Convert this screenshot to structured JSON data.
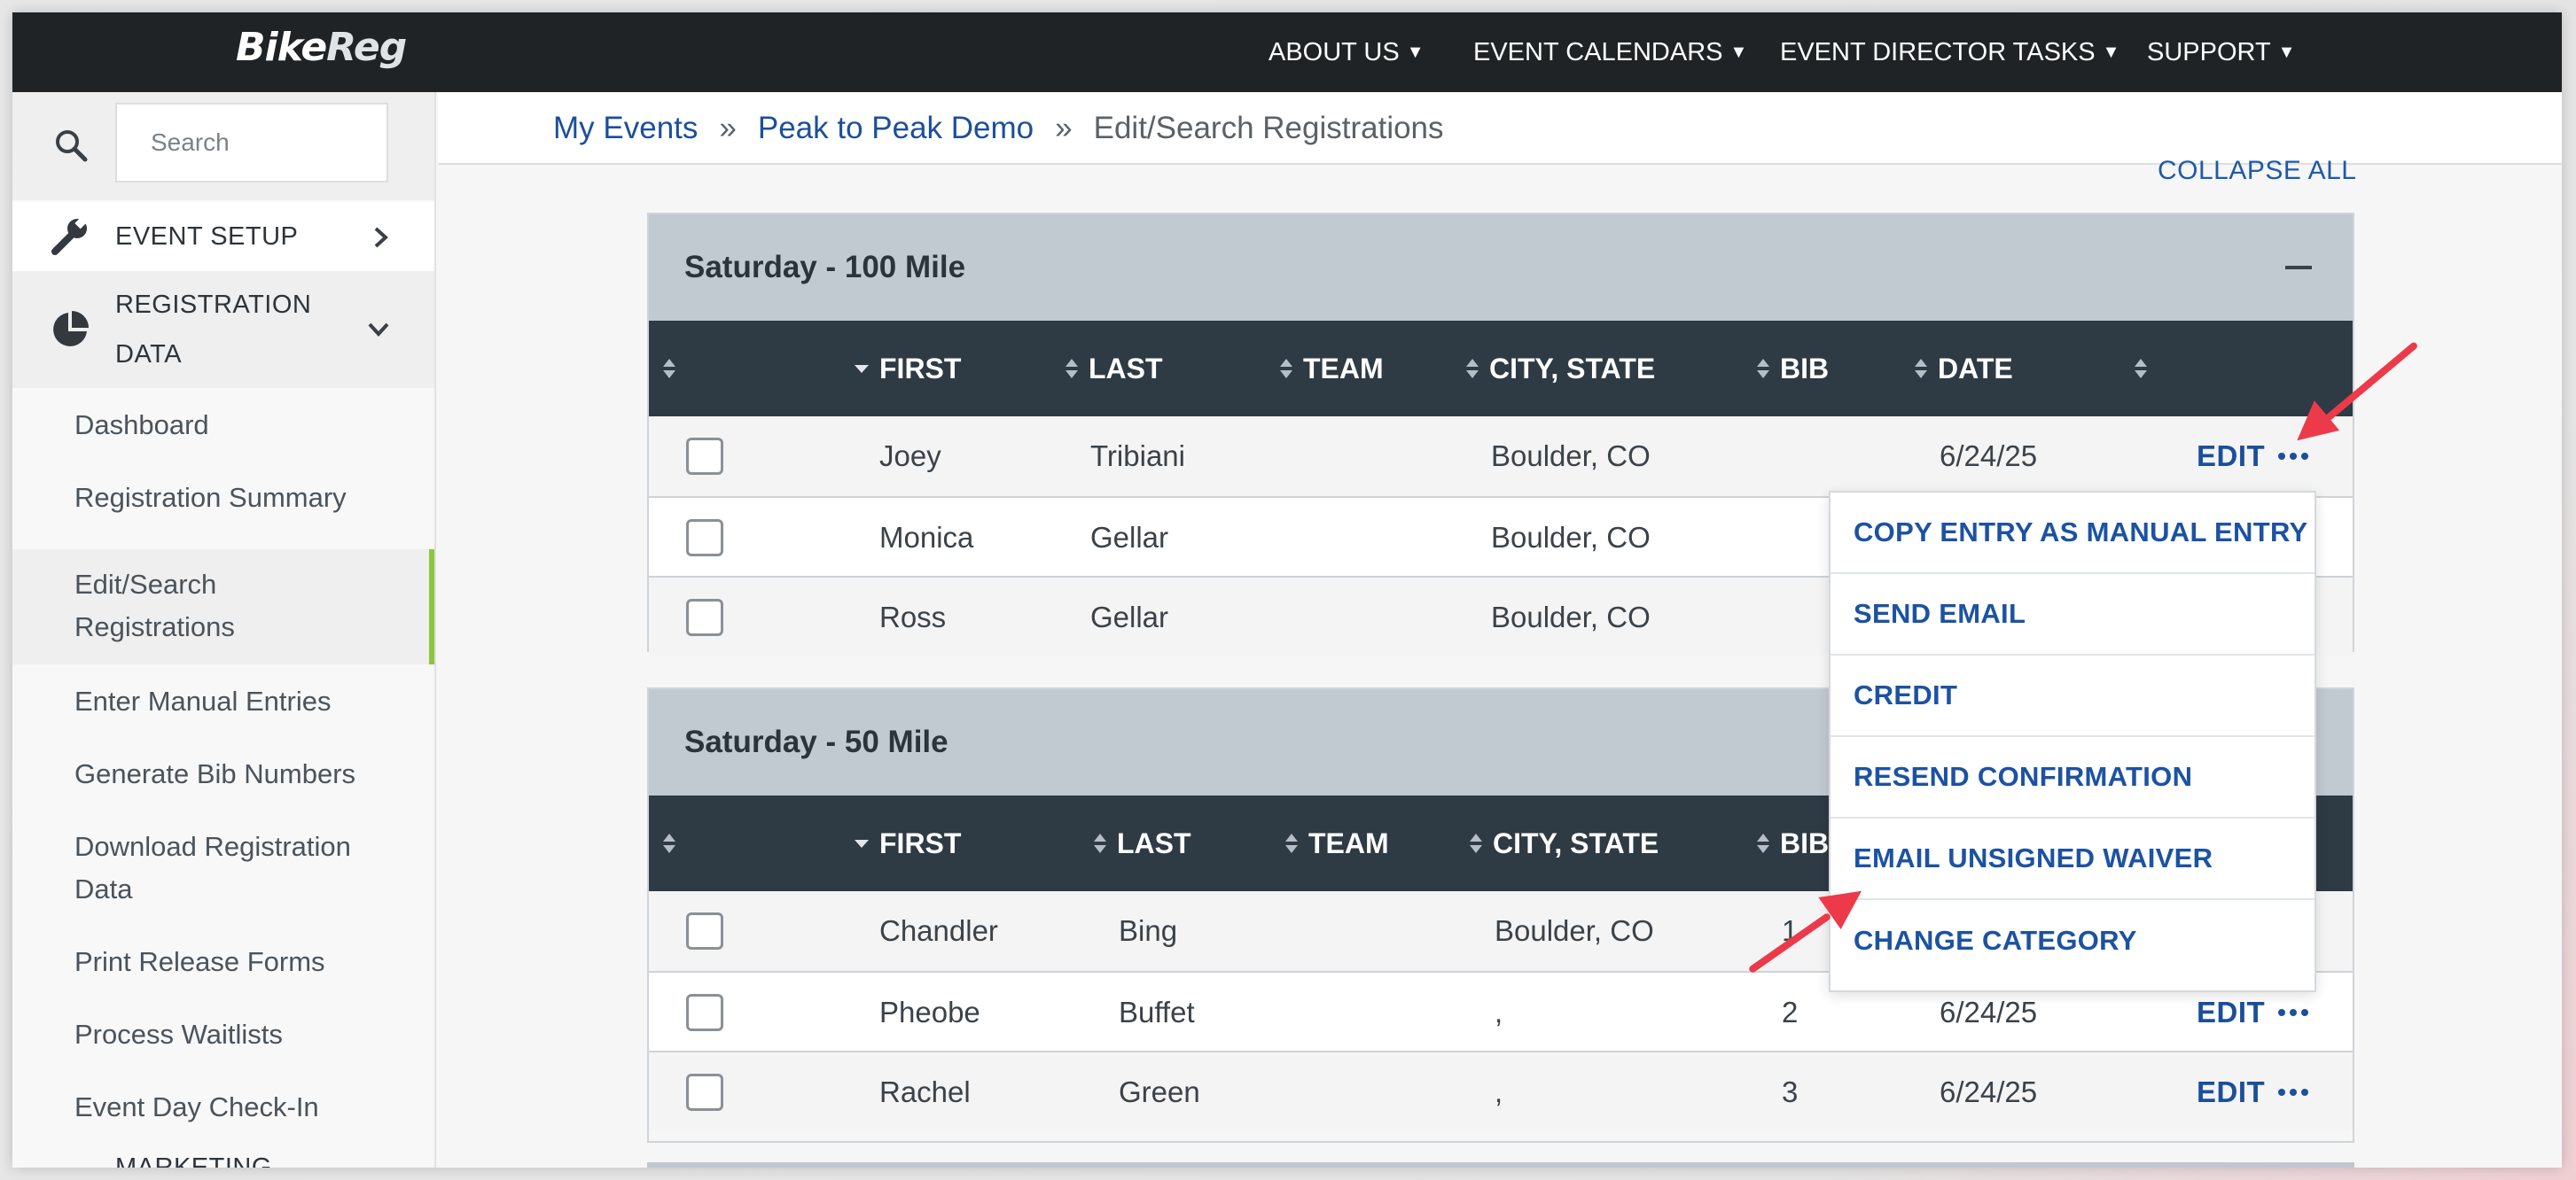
{
  "brand": {
    "logo_bike": "Bike",
    "logo_reg": "Reg"
  },
  "topnav": {
    "about": "ABOUT US",
    "calendars": "EVENT CALENDARS",
    "director": "EVENT DIRECTOR TASKS",
    "support": "SUPPORT"
  },
  "sidebar": {
    "search_placeholder": "Search",
    "event_setup": "EVENT SETUP",
    "registration_data_line1": "REGISTRATION",
    "registration_data_line2": "DATA",
    "items": [
      {
        "label": "Dashboard"
      },
      {
        "label": "Registration Summary"
      },
      {
        "label_line1": "Edit/Search",
        "label_line2": "Registrations",
        "active": true
      },
      {
        "label": "Enter Manual Entries"
      },
      {
        "label": "Generate Bib Numbers"
      },
      {
        "label_line1": "Download Registration",
        "label_line2": "Data"
      },
      {
        "label": "Print Release Forms"
      },
      {
        "label": "Process Waitlists"
      },
      {
        "label": "Event Day Check-In"
      }
    ],
    "marketing": "MARKETING"
  },
  "breadcrumb": {
    "my_events": "My Events",
    "sep": "»",
    "event": "Peak to Peak Demo",
    "current": "Edit/Search Registrations"
  },
  "collapse_all": "COLLAPSE ALL",
  "columns": {
    "first": "FIRST",
    "last": "LAST",
    "team": "TEAM",
    "city": "CITY, STATE",
    "bib": "BIB",
    "date": "DATE"
  },
  "edit_label": "EDIT",
  "groups": [
    {
      "title": "Saturday - 100 Mile",
      "rows": [
        {
          "first": "Joey",
          "last": "Tribiani",
          "team": "",
          "city": "Boulder, CO",
          "bib": "",
          "date": "6/24/25"
        },
        {
          "first": "Monica",
          "last": "Gellar",
          "team": "",
          "city": "Boulder, CO",
          "bib": "",
          "date": ""
        },
        {
          "first": "Ross",
          "last": "Gellar",
          "team": "",
          "city": "Boulder, CO",
          "bib": "",
          "date": ""
        }
      ]
    },
    {
      "title": "Saturday - 50 Mile",
      "rows": [
        {
          "first": "Chandler",
          "last": "Bing",
          "team": "",
          "city": "Boulder, CO",
          "bib": "1",
          "date": ""
        },
        {
          "first": "Pheobe",
          "last": "Buffet",
          "team": "",
          "city": ",",
          "bib": "2",
          "date": "6/24/25"
        },
        {
          "first": "Rachel",
          "last": "Green",
          "team": "",
          "city": ",",
          "bib": "3",
          "date": "6/24/25"
        }
      ]
    }
  ],
  "dropdown": [
    "COPY ENTRY AS MANUAL ENTRY",
    "SEND EMAIL",
    "CREDIT",
    "RESEND CONFIRMATION",
    "EMAIL UNSIGNED WAIVER",
    "CHANGE CATEGORY"
  ],
  "colors": {
    "topbar": "#1f2326",
    "link": "#1b4f9c",
    "table_header": "#2e3a44",
    "group_header": "#c1c9d1",
    "active_marker": "#8cc63f",
    "arrow": "#ec3a4a"
  }
}
